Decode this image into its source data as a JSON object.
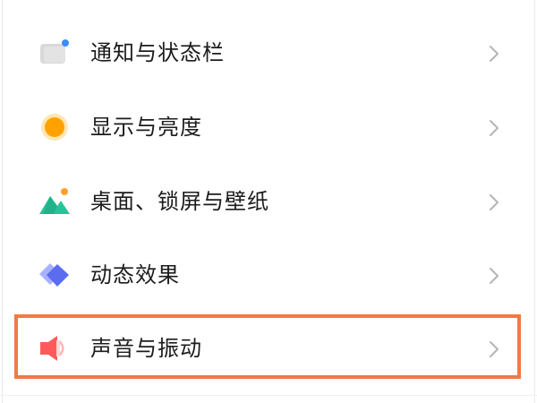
{
  "settings_list": {
    "items": [
      {
        "label": "通知与状态栏",
        "icon": "notification-icon"
      },
      {
        "label": "显示与亮度",
        "icon": "brightness-icon"
      },
      {
        "label": "桌面、锁屏与壁纸",
        "icon": "wallpaper-icon"
      },
      {
        "label": "动态效果",
        "icon": "animation-icon"
      },
      {
        "label": "声音与振动",
        "icon": "sound-icon"
      }
    ],
    "highlighted_item": "声音与振动"
  },
  "colors": {
    "highlight_border": "#f07a46",
    "notification_icon": "#d6d6d6",
    "notification_dot": "#3b8cff",
    "brightness_icon": "#ffa200",
    "wallpaper_icon": "#25c59a",
    "wallpaper_sun": "#ff9f2a",
    "animation_icon": "#5b6cf0",
    "sound_icon": "#ff5a5a",
    "chevron": "#b5b5b5",
    "text": "#1c1c1c"
  }
}
